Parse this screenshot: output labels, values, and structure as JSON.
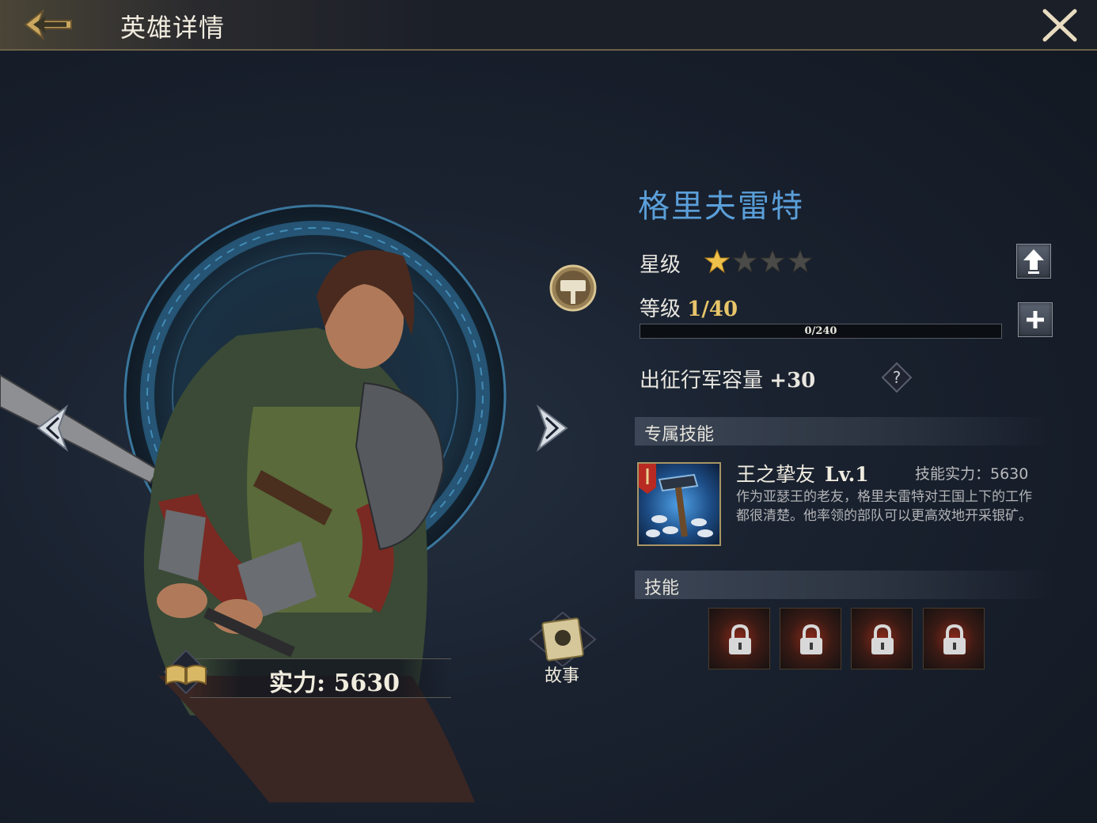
{
  "header": {
    "title": "英雄详情"
  },
  "hero": {
    "name": "格里夫雷特",
    "power_label": "实力: 5630",
    "story_label": "故事"
  },
  "stats": {
    "star_label": "星级",
    "stars_filled": 1,
    "stars_total": 4,
    "level_label": "等级",
    "level_value": "1/40",
    "exp_text": "0/240",
    "exp_fraction": 0,
    "capacity_label": "出征行军容量",
    "capacity_value": "+30"
  },
  "exclusive_skill": {
    "section_title": "专属技能",
    "name": "王之挚友",
    "level": "Lv.1",
    "power": "技能实力：5630",
    "description": "作为亚瑟王的老友，格里夫雷特对王国上下的工作都很清楚。他率领的部队可以更高效地开采银矿。"
  },
  "skills": {
    "section_title": "技能",
    "slots": [
      {
        "state": "locked"
      },
      {
        "state": "locked"
      },
      {
        "state": "locked"
      },
      {
        "state": "locked"
      }
    ]
  },
  "colors": {
    "hero_name": "#5a9fd9",
    "star_filled": "#f0c14a",
    "star_empty": "#4a4a48",
    "level_value": "#e8c56a"
  }
}
